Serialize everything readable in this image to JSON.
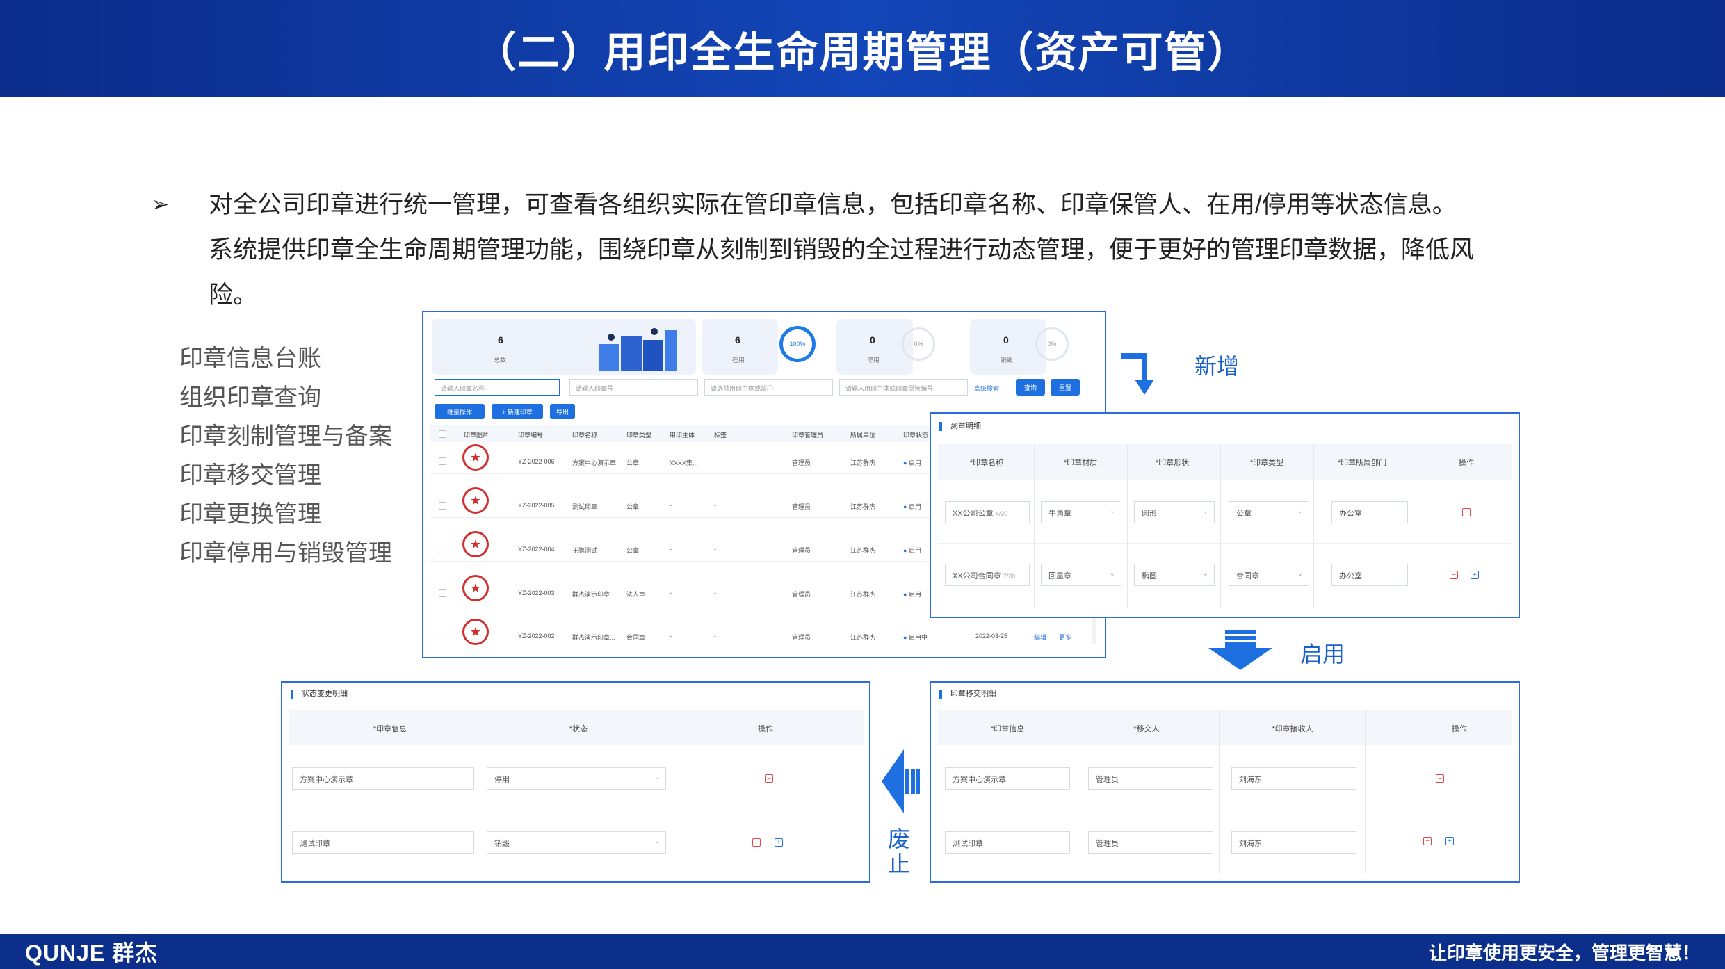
{
  "title": "（二）用印全生命周期管理（资产可管）",
  "description": {
    "bullet": "➢",
    "lines": [
      "对全公司印章进行统一管理，可查看各组织实际在管印章信息，包括印章名称、印章保管人、在用/停用等状态信息。",
      "系统提供印章全生命周期管理功能，围绕印章从刻制到销毁的全过程进行动态管理，便于更好的管理印章数据，降低风",
      "险。"
    ]
  },
  "menu": [
    "印章信息台账",
    "组织印章查询",
    "印章刻制管理与备案",
    "印章移交管理",
    "印章更换管理",
    "印章停用与销毁管理"
  ],
  "flow": {
    "add": "新增",
    "enable": "启用",
    "abolish_1": "废",
    "abolish_2": "止"
  },
  "colors": {
    "brand": "#0d2f8c",
    "accent": "#1e6fe0",
    "danger": "#d32f2f"
  },
  "ledger": {
    "stats": [
      {
        "value": "6",
        "label": "总数"
      },
      {
        "value": "6",
        "label": "在用",
        "ring": "100%"
      },
      {
        "value": "0",
        "label": "停用",
        "ring": "0%"
      },
      {
        "value": "0",
        "label": "销毁",
        "ring": "0%"
      }
    ],
    "search_placeholders": [
      "请输入印章名称",
      "请输入印章号",
      "请选择用印主体或部门",
      "请输入用印主体或印章保管编号"
    ],
    "advanced": "高级搜索",
    "query": "查询",
    "reset": "重置",
    "batch": "批量操作",
    "new_seal": "+ 新建印章",
    "export": "导出",
    "columns": [
      "印章图片",
      "印章编号",
      "印章名称",
      "印章类型",
      "用印主体",
      "标签",
      "印章管理员",
      "所属单位",
      "印章状态"
    ],
    "rows": [
      {
        "code": "YZ-2022-006",
        "name": "方案中心演示章",
        "type": "公章",
        "subject": "XXXX集...",
        "tag": "-",
        "admin": "管理员",
        "unit": "江苏群杰",
        "status": "启用"
      },
      {
        "code": "YZ-2022-005",
        "name": "测试印章",
        "type": "公章",
        "subject": "-",
        "tag": "-",
        "admin": "管理员",
        "unit": "江苏群杰",
        "status": "启用"
      },
      {
        "code": "YZ-2022-004",
        "name": "王鹏测试",
        "type": "公章",
        "subject": "-",
        "tag": "-",
        "admin": "管理员",
        "unit": "江苏群杰",
        "status": "启用"
      },
      {
        "code": "YZ-2022-003",
        "name": "群杰演示印章...",
        "type": "法人章",
        "subject": "-",
        "tag": "-",
        "admin": "管理员",
        "unit": "江苏群杰",
        "status": "启用"
      },
      {
        "code": "YZ-2022-002",
        "name": "群杰演示印章...",
        "type": "合同章",
        "subject": "-",
        "tag": "-",
        "admin": "管理员",
        "unit": "江苏群杰",
        "status": "启用中",
        "date": "2022-03-25",
        "edit": "编辑",
        "more": "更多"
      }
    ]
  },
  "engrave": {
    "title": "刻章明细",
    "columns": [
      "*印章名称",
      "*印章材质",
      "*印章形状",
      "*印章类型",
      "*印章所属部门",
      "操作"
    ],
    "rows": [
      {
        "name": "XX公司公章",
        "count": "4/30",
        "material": "牛角章",
        "shape": "圆形",
        "type": "公章",
        "dept": "办公室"
      },
      {
        "name": "XX公司合同章",
        "count": "7/30",
        "material": "回墨章",
        "shape": "椭圆",
        "type": "合同章",
        "dept": "办公室"
      }
    ]
  },
  "transfer": {
    "title": "印章移交明细",
    "columns": [
      "*印章信息",
      "*移交人",
      "*印章接收人",
      "操作"
    ],
    "rows": [
      {
        "seal": "方案中心演示章",
        "from": "管理员",
        "to": "刘海东"
      },
      {
        "seal": "测试印章",
        "from": "管理员",
        "to": "刘海东"
      }
    ]
  },
  "status_change": {
    "title": "状态变更明细",
    "columns": [
      "*印章信息",
      "*状态",
      "操作"
    ],
    "rows": [
      {
        "seal": "方案中心演示章",
        "status": "停用"
      },
      {
        "seal": "测试印章",
        "status": "销毁"
      }
    ]
  },
  "footer": {
    "brand": "QUNJE 群杰",
    "slogan": "让印章使用更安全，管理更智慧！"
  }
}
